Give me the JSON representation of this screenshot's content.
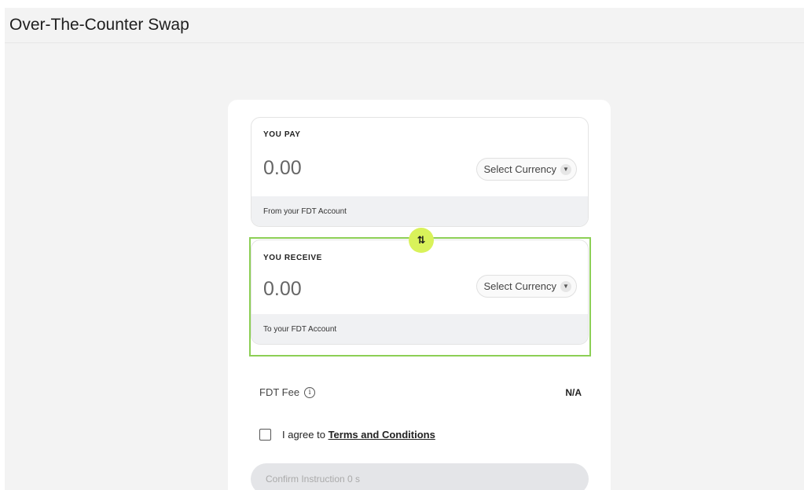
{
  "header": {
    "title": "Over-The-Counter Swap"
  },
  "pay": {
    "label": "YOU PAY",
    "amount": "0.00",
    "currency_placeholder": "Select Currency",
    "footer": "From your FDT Account"
  },
  "receive": {
    "label": "YOU RECEIVE",
    "amount": "0.00",
    "currency_placeholder": "Select Currency",
    "footer": "To your FDT Account"
  },
  "swap": {
    "icon": "swap-vertical-icon",
    "glyph": "⇅"
  },
  "fee": {
    "label": "FDT Fee",
    "value": "N/A"
  },
  "agree": {
    "prefix": "I agree to",
    "link": "Terms and Conditions",
    "checked": false
  },
  "confirm": {
    "label": "Confirm Instruction",
    "countdown": "0 s"
  },
  "colors": {
    "accent_lime": "#d9f25a",
    "focus_green": "#8ccf55",
    "background": "#f3f3f3"
  }
}
